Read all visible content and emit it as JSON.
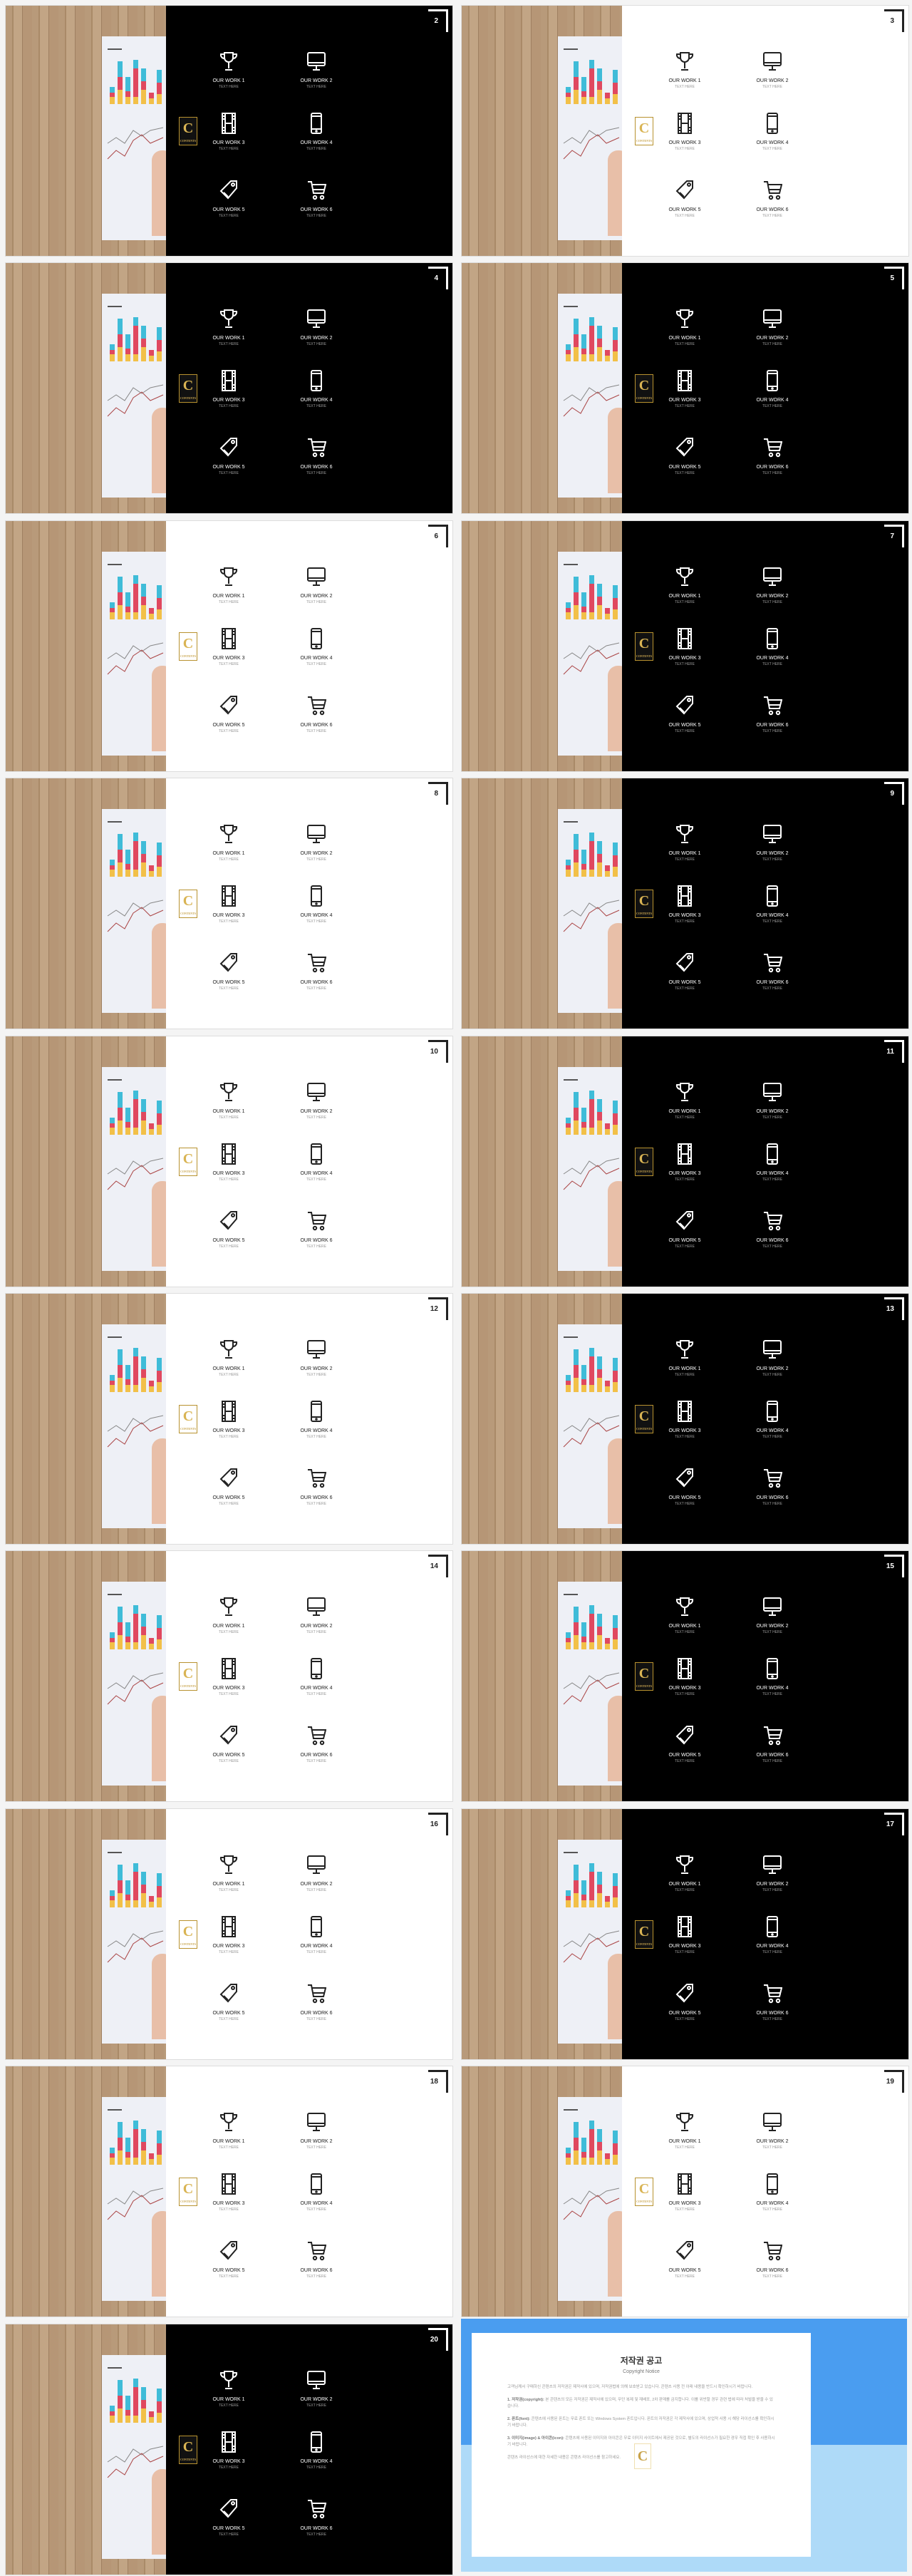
{
  "slides": [
    {
      "number": "2",
      "theme": "black"
    },
    {
      "number": "3",
      "theme": "white"
    },
    {
      "number": "4",
      "theme": "black"
    },
    {
      "number": "5",
      "theme": "black"
    },
    {
      "number": "6",
      "theme": "white"
    },
    {
      "number": "7",
      "theme": "black"
    },
    {
      "number": "8",
      "theme": "white"
    },
    {
      "number": "9",
      "theme": "black"
    },
    {
      "number": "10",
      "theme": "white"
    },
    {
      "number": "11",
      "theme": "black"
    },
    {
      "number": "12",
      "theme": "white"
    },
    {
      "number": "13",
      "theme": "black"
    },
    {
      "number": "14",
      "theme": "white"
    },
    {
      "number": "15",
      "theme": "black"
    },
    {
      "number": "16",
      "theme": "white"
    },
    {
      "number": "17",
      "theme": "black"
    },
    {
      "number": "18",
      "theme": "white"
    },
    {
      "number": "19",
      "theme": "white"
    },
    {
      "number": "20",
      "theme": "black"
    }
  ],
  "works": [
    {
      "title": "OUR WORK 1",
      "sub": "TEXT HERE",
      "icon": "trophy-icon"
    },
    {
      "title": "OUR WORK 2",
      "sub": "TEXT HERE",
      "icon": "monitor-icon"
    },
    {
      "title": "OUR WORK 3",
      "sub": "TEXT HERE",
      "icon": "film-icon"
    },
    {
      "title": "OUR WORK 4",
      "sub": "TEXT HERE",
      "icon": "smartphone-icon"
    },
    {
      "title": "OUR WORK 5",
      "sub": "TEXT HERE",
      "icon": "tag-icon"
    },
    {
      "title": "OUR WORK 6",
      "sub": "TEXT HERE",
      "icon": "cart-icon"
    }
  ],
  "logo": {
    "letter": "C",
    "word": "CONTENTS"
  },
  "copyright": {
    "title": "저작권 공고",
    "subtitle": "Copyright Notice",
    "intro": "고객님께서 구매하신 콘텐츠의 저작권은 제작사에 있으며, 저작권법에 의해 보호받고 있습니다. 콘텐츠 사용 전 아래 내용을 반드시 확인하시기 바랍니다.",
    "items": [
      {
        "head": "1. 저작권(copyright):",
        "body": "본 콘텐츠의 모든 저작권은 제작사에 있으며, 무단 복제 및 재배포, 2차 판매를 금지합니다. 이를 위반할 경우 관련 법에 따라 처벌을 받을 수 있습니다."
      },
      {
        "head": "2. 폰트(font):",
        "body": "콘텐츠에 사용된 폰트는 무료 폰트 또는 Windows System 폰트입니다. 폰트의 저작권은 각 제작사에 있으며, 상업적 사용 시 해당 라이선스를 확인하시기 바랍니다."
      },
      {
        "head": "3. 이미지(image) & 아이콘(icon):",
        "body": "콘텐츠에 사용된 이미지와 아이콘은 무료 이미지 사이트에서 제공된 것으로, 별도의 라이선스가 필요한 경우 직접 확인 후 사용하시기 바랍니다."
      }
    ],
    "outro": "콘텐츠 라이선스에 대한 자세한 내용은 콘텐츠 라이선스를 참고하세요.",
    "logo": "C"
  },
  "colors": {
    "black": "#000000",
    "white": "#ffffff",
    "blue": "#4a9df0",
    "light_blue": "#aedaf8",
    "gold": "#c9a34a"
  }
}
